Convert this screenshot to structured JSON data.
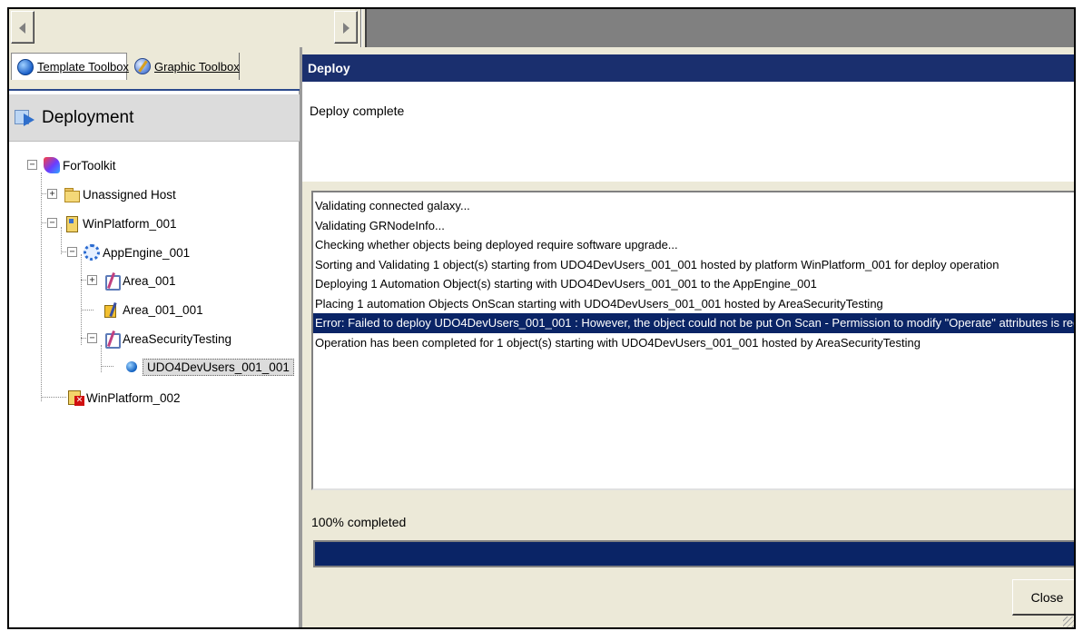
{
  "tabs": {
    "template_toolbox": "Template Toolbox",
    "graphic_toolbox": "Graphic Toolbox"
  },
  "panel": {
    "title": "Deployment"
  },
  "tree": {
    "items": [
      {
        "label": "ForToolkit",
        "icon": "galaxy-icon"
      },
      {
        "label": "Unassigned Host",
        "icon": "folder-icon"
      },
      {
        "label": "WinPlatform_001",
        "icon": "platform-icon"
      },
      {
        "label": "AppEngine_001",
        "icon": "engine-icon"
      },
      {
        "label": "Area_001",
        "icon": "area-icon"
      },
      {
        "label": "Area_001_001",
        "icon": "area-deployed-icon"
      },
      {
        "label": "AreaSecurityTesting",
        "icon": "area-icon"
      },
      {
        "label": "UDO4DevUsers_001_001",
        "icon": "udo-icon"
      },
      {
        "label": "WinPlatform_002",
        "icon": "platform-error-icon"
      }
    ]
  },
  "dialog": {
    "title": "Deploy",
    "status": "Deploy complete",
    "log": [
      "Validating connected galaxy...",
      "Validating GRNodeInfo...",
      "Checking whether objects being deployed require software upgrade...",
      "Sorting and Validating 1 object(s) starting from UDO4DevUsers_001_001 hosted by platform WinPlatform_001 for deploy operation",
      "Deploying 1 Automation Object(s) starting with UDO4DevUsers_001_001 to the AppEngine_001",
      "Placing 1 automation Objects OnScan starting with UDO4DevUsers_001_001 hosted by AreaSecurityTesting",
      "Error: Failed to deploy UDO4DevUsers_001_001 : However, the object could not be put On Scan - Permission to modify \"Operate\" attributes is required",
      "Operation has been completed for 1 object(s) starting with UDO4DevUsers_001_001 hosted by AreaSecurityTesting"
    ],
    "progress_text": "100% completed",
    "progress_value": 100,
    "close_label": "Close"
  },
  "colors": {
    "title_bar": "#1a2f6e",
    "selection": "#0a2466",
    "dialog_bg": "#ece9d8"
  }
}
